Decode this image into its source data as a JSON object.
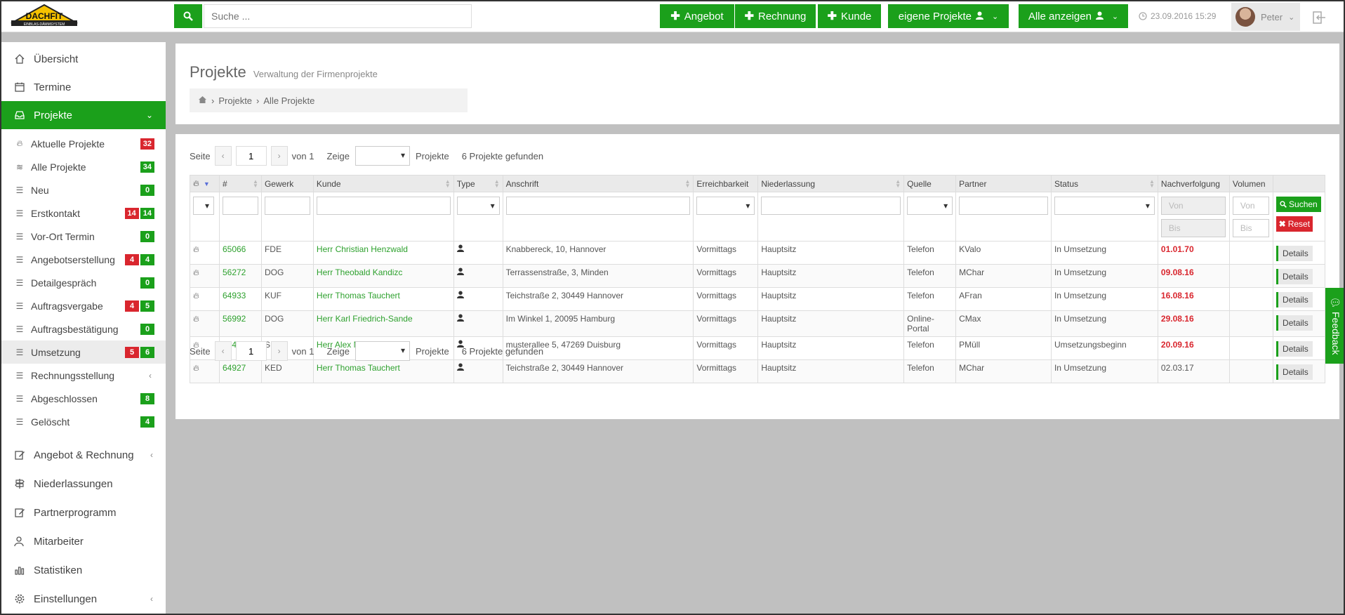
{
  "header": {
    "logo_text": "DACHFIT",
    "logo_sub": "EINBLAS-DÄMMSYSTEM",
    "search_placeholder": "Suche ...",
    "buttons": {
      "angebot": "Angebot",
      "rechnung": "Rechnung",
      "kunde": "Kunde",
      "eigene_projekte": "eigene Projekte",
      "alle_anzeigen": "Alle anzeigen"
    },
    "datetime": "23.09.2016 15:29",
    "user_name": "Peter"
  },
  "sidebar": {
    "items": {
      "uebersicht": "Übersicht",
      "termine": "Termine",
      "projekte": "Projekte",
      "angebot_rechnung": "Angebot & Rechnung",
      "niederlassungen": "Niederlassungen",
      "partnerprogramm": "Partnerprogramm",
      "mitarbeiter": "Mitarbeiter",
      "statistiken": "Statistiken",
      "einstellungen": "Einstellungen"
    },
    "sub": [
      {
        "label": "Aktuelle Projekte",
        "red": "32",
        "green": ""
      },
      {
        "label": "Alle Projekte",
        "red": "",
        "green": "34"
      },
      {
        "label": "Neu",
        "red": "",
        "green": "0"
      },
      {
        "label": "Erstkontakt",
        "red": "14",
        "green": "14"
      },
      {
        "label": "Vor-Ort Termin",
        "red": "",
        "green": "0"
      },
      {
        "label": "Angebotserstellung",
        "red": "4",
        "green": "4"
      },
      {
        "label": "Detailgespräch",
        "red": "",
        "green": "0"
      },
      {
        "label": "Auftragsvergabe",
        "red": "4",
        "green": "5"
      },
      {
        "label": "Auftragsbestätigung",
        "red": "",
        "green": "0"
      },
      {
        "label": "Umsetzung",
        "red": "5",
        "green": "6"
      },
      {
        "label": "Rechnungsstellung",
        "red": "",
        "green": ""
      },
      {
        "label": "Abgeschlossen",
        "red": "",
        "green": "8"
      },
      {
        "label": "Gelöscht",
        "red": "",
        "green": "4"
      }
    ]
  },
  "page": {
    "title": "Projekte",
    "subtitle": "Verwaltung der Firmenprojekte",
    "breadcrumb": {
      "level1": "Projekte",
      "level2": "Alle Projekte"
    }
  },
  "pager": {
    "seite": "Seite",
    "page_value": "1",
    "von": "von 1",
    "zeige": "Zeige",
    "projekte": "Projekte",
    "found": "6 Projekte gefunden"
  },
  "table": {
    "headers": {
      "num": "#",
      "gewerk": "Gewerk",
      "kunde": "Kunde",
      "type": "Type",
      "anschrift": "Anschrift",
      "erreichbarkeit": "Erreichbarkeit",
      "niederlassung": "Niederlassung",
      "quelle": "Quelle",
      "partner": "Partner",
      "status": "Status",
      "nachverfolgung": "Nachverfolgung",
      "volumen": "Volumen"
    },
    "filters": {
      "von": "Von",
      "bis": "Bis",
      "suchen": "Suchen",
      "reset": "Reset"
    },
    "details_label": "Details",
    "rows": [
      {
        "id": "65066",
        "gewerk": "FDE",
        "kunde": "Herr Christian Henzwald",
        "anschrift": "Knabbereck, 10, Hannover",
        "erreichbarkeit": "Vormittags",
        "niederlassung": "Hauptsitz",
        "quelle": "Telefon",
        "partner": "KValo",
        "status": "In Umsetzung",
        "nachverfolgung": "01.01.70",
        "overdue": true
      },
      {
        "id": "56272",
        "gewerk": "DOG",
        "kunde": "Herr Theobald Kandizc",
        "anschrift": "Terrassenstraße, 3, Minden",
        "erreichbarkeit": "Vormittags",
        "niederlassung": "Hauptsitz",
        "quelle": "Telefon",
        "partner": "MChar",
        "status": "In Umsetzung",
        "nachverfolgung": "09.08.16",
        "overdue": true
      },
      {
        "id": "64933",
        "gewerk": "KUF",
        "kunde": "Herr Thomas Tauchert",
        "anschrift": "Teichstraße 2, 30449 Hannover",
        "erreichbarkeit": "Vormittags",
        "niederlassung": "Hauptsitz",
        "quelle": "Telefon",
        "partner": "AFran",
        "status": "In Umsetzung",
        "nachverfolgung": "16.08.16",
        "overdue": true
      },
      {
        "id": "56992",
        "gewerk": "DOG",
        "kunde": "Herr Karl Friedrich-Sande",
        "anschrift": "Im Winkel 1, 20095 Hamburg",
        "erreichbarkeit": "Vormittags",
        "niederlassung": "Hauptsitz",
        "quelle": "Online-Portal",
        "partner": "CMax",
        "status": "In Umsetzung",
        "nachverfolgung": "29.08.16",
        "overdue": true
      },
      {
        "id": "64477",
        "gewerk": "SDD",
        "kunde": "Herr Alex Müller",
        "anschrift": "musterallee 5, 47269 Duisburg",
        "erreichbarkeit": "Vormittags",
        "niederlassung": "Hauptsitz",
        "quelle": "Telefon",
        "partner": "PMüll",
        "status": "Umsetzungsbeginn",
        "nachverfolgung": "20.09.16",
        "overdue": true
      },
      {
        "id": "64927",
        "gewerk": "KED",
        "kunde": "Herr Thomas Tauchert",
        "anschrift": "Teichstraße 2, 30449 Hannover",
        "erreichbarkeit": "Vormittags",
        "niederlassung": "Hauptsitz",
        "quelle": "Telefon",
        "partner": "MChar",
        "status": "In Umsetzung",
        "nachverfolgung": "02.03.17",
        "overdue": false
      }
    ]
  },
  "feedback_label": "Feedback",
  "colors": {
    "accent": "#1ba01b",
    "danger": "#d9262e"
  }
}
